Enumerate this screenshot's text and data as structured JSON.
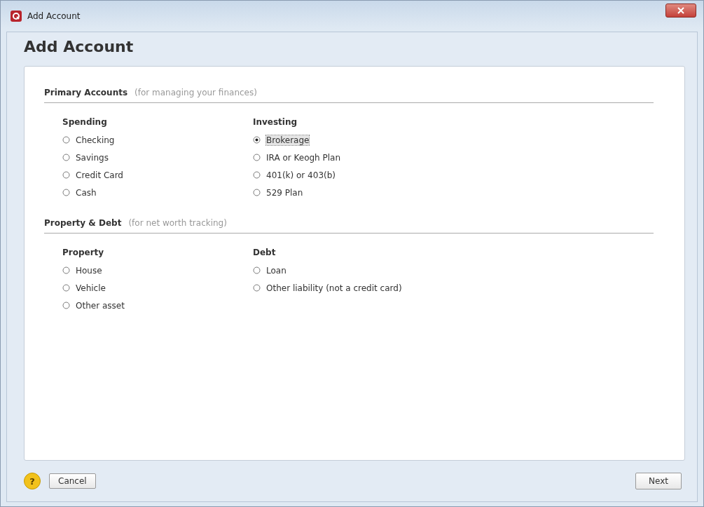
{
  "window": {
    "title": "Add Account"
  },
  "header": {
    "title": "Add Account"
  },
  "sections": [
    {
      "title": "Primary Accounts",
      "hint": "(for managing your finances)",
      "groups": [
        {
          "title": "Spending",
          "options": [
            {
              "label": "Checking",
              "selected": false
            },
            {
              "label": "Savings",
              "selected": false
            },
            {
              "label": "Credit Card",
              "selected": false
            },
            {
              "label": "Cash",
              "selected": false
            }
          ]
        },
        {
          "title": "Investing",
          "options": [
            {
              "label": "Brokerage",
              "selected": true
            },
            {
              "label": "IRA or Keogh Plan",
              "selected": false
            },
            {
              "label": "401(k) or 403(b)",
              "selected": false
            },
            {
              "label": "529 Plan",
              "selected": false
            }
          ]
        }
      ]
    },
    {
      "title": "Property & Debt",
      "hint": "(for net worth tracking)",
      "groups": [
        {
          "title": "Property",
          "options": [
            {
              "label": "House",
              "selected": false
            },
            {
              "label": "Vehicle",
              "selected": false
            },
            {
              "label": "Other asset",
              "selected": false
            }
          ]
        },
        {
          "title": "Debt",
          "options": [
            {
              "label": "Loan",
              "selected": false
            },
            {
              "label": "Other liability (not a credit card)",
              "selected": false
            }
          ]
        }
      ]
    }
  ],
  "footer": {
    "help": "?",
    "cancel": "Cancel",
    "next": "Next"
  }
}
